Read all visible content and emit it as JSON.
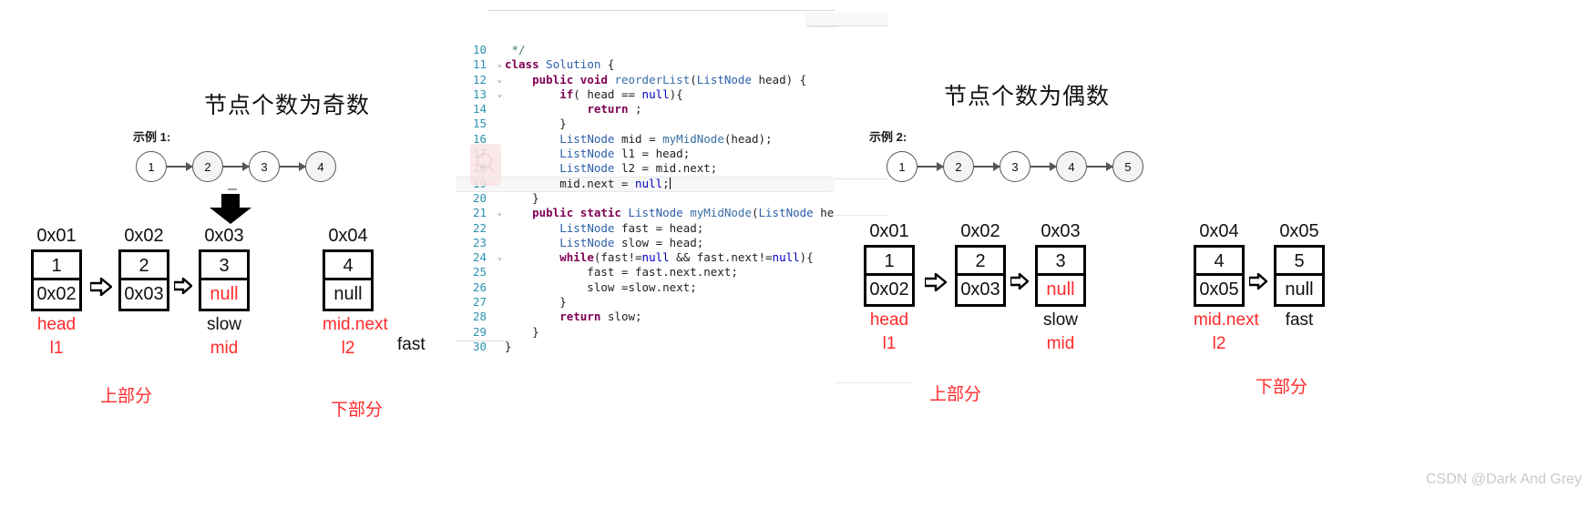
{
  "left_panel": {
    "title": "节点个数为奇数",
    "example_label": "示例 1:",
    "chain": {
      "nodes": [
        "1",
        "2",
        "3",
        "4"
      ]
    },
    "nodes": [
      {
        "addr": "0x01",
        "value": "1",
        "next": "0x02",
        "next_red": false,
        "label1": "head",
        "label1_red": true,
        "label2": "l1",
        "label2_red": true
      },
      {
        "addr": "0x02",
        "value": "2",
        "next": "0x03",
        "next_red": false,
        "label1": "",
        "label1_red": false,
        "label2": "",
        "label2_red": false
      },
      {
        "addr": "0x03",
        "value": "3",
        "next": "null",
        "next_red": true,
        "label1": "slow",
        "label1_red": false,
        "label2": "mid",
        "label2_red": true
      },
      {
        "addr": "0x04",
        "value": "4",
        "next": "null",
        "next_red": false,
        "label1": "mid.next",
        "label1_red": true,
        "label2": "l2",
        "label2_red": true
      }
    ],
    "fast_label": "fast",
    "upper_part": "上部分",
    "lower_part": "下部分"
  },
  "right_panel": {
    "title": "节点个数为偶数",
    "example_label": "示例 2:",
    "chain": {
      "nodes": [
        "1",
        "2",
        "3",
        "4",
        "5"
      ]
    },
    "nodes": [
      {
        "addr": "0x01",
        "value": "1",
        "next": "0x02",
        "next_red": false,
        "label1": "head",
        "label1_red": true,
        "label2": "l1",
        "label2_red": true
      },
      {
        "addr": "0x02",
        "value": "2",
        "next": "0x03",
        "next_red": false,
        "label1": "",
        "label1_red": false,
        "label2": "",
        "label2_red": false
      },
      {
        "addr": "0x03",
        "value": "3",
        "next": "null",
        "next_red": true,
        "label1": "slow",
        "label1_red": false,
        "label2": "mid",
        "label2_red": true
      },
      {
        "addr": "0x04",
        "value": "4",
        "next": "0x05",
        "next_red": false,
        "label1": "mid.next",
        "label1_red": true,
        "label2": "l2",
        "label2_red": true
      },
      {
        "addr": "0x05",
        "value": "5",
        "next": "null",
        "next_red": false,
        "label1": "fast",
        "label1_red": false,
        "label2": "",
        "label2_red": false
      }
    ],
    "upper_part": "上部分",
    "lower_part": "下部分"
  },
  "editor": {
    "lines": [
      {
        "n": "10",
        "fold": "",
        "text": " */",
        "hl": false,
        "caret": false
      },
      {
        "n": "11",
        "fold": "v",
        "text": "class Solution {",
        "hl": false,
        "caret": false
      },
      {
        "n": "12",
        "fold": "v",
        "text": "    public void reorderList(ListNode head) {",
        "hl": false,
        "caret": false
      },
      {
        "n": "13",
        "fold": "v",
        "text": "        if( head == null){",
        "hl": false,
        "caret": false
      },
      {
        "n": "14",
        "fold": "",
        "text": "            return ;",
        "hl": false,
        "caret": false
      },
      {
        "n": "15",
        "fold": "",
        "text": "        }",
        "hl": false,
        "caret": false
      },
      {
        "n": "16",
        "fold": "",
        "text": "        ListNode mid = myMidNode(head);",
        "hl": false,
        "caret": false
      },
      {
        "n": "17",
        "fold": "",
        "text": "        ListNode l1 = head;",
        "hl": false,
        "caret": false
      },
      {
        "n": "18",
        "fold": "",
        "text": "        ListNode l2 = mid.next;",
        "hl": false,
        "caret": false
      },
      {
        "n": "19",
        "fold": "",
        "text": "        mid.next = null;",
        "hl": true,
        "caret": true
      },
      {
        "n": "20",
        "fold": "",
        "text": "    }",
        "hl": false,
        "caret": false
      },
      {
        "n": "21",
        "fold": "v",
        "text": "    public static ListNode myMidNode(ListNode head){",
        "hl": false,
        "caret": false
      },
      {
        "n": "22",
        "fold": "",
        "text": "        ListNode fast = head;",
        "hl": false,
        "caret": false
      },
      {
        "n": "23",
        "fold": "",
        "text": "        ListNode slow = head;",
        "hl": false,
        "caret": false
      },
      {
        "n": "24",
        "fold": "v",
        "text": "        while(fast!=null && fast.next!=null){",
        "hl": false,
        "caret": false
      },
      {
        "n": "25",
        "fold": "",
        "text": "            fast = fast.next.next;",
        "hl": false,
        "caret": false
      },
      {
        "n": "26",
        "fold": "",
        "text": "            slow =slow.next;",
        "hl": false,
        "caret": false
      },
      {
        "n": "27",
        "fold": "",
        "text": "        }",
        "hl": false,
        "caret": false
      },
      {
        "n": "28",
        "fold": "",
        "text": "        return slow;",
        "hl": false,
        "caret": false
      },
      {
        "n": "29",
        "fold": "",
        "text": "    }",
        "hl": false,
        "caret": false
      },
      {
        "n": "30",
        "fold": "",
        "text": "}",
        "hl": false,
        "caret": false
      }
    ]
  },
  "watermark": "CSDN @Dark And Grey"
}
